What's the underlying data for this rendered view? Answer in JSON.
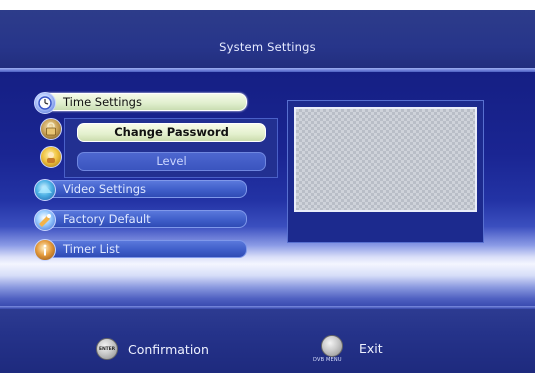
{
  "header": {
    "title": "System Settings"
  },
  "menu": {
    "items": [
      {
        "label": "Time Settings",
        "icon": "clock-icon",
        "state": "highlight"
      },
      {
        "label": "",
        "icon": "lock-icon",
        "state": "normal"
      },
      {
        "label": "",
        "icon": "parental-icon",
        "state": "normal"
      },
      {
        "label": "Video Settings",
        "icon": "video-icon",
        "state": "normal"
      },
      {
        "label": "Factory Default",
        "icon": "factory-default-icon",
        "state": "normal"
      },
      {
        "label": "Timer List",
        "icon": "info-icon",
        "state": "normal"
      }
    ],
    "submenu": [
      {
        "label": "Change Password",
        "state": "highlight"
      },
      {
        "label": "Level",
        "state": "normal"
      }
    ]
  },
  "footer": {
    "confirm": {
      "button_text": "ENTER",
      "label": "Confirmation"
    },
    "exit": {
      "button_text": "DVB MENU",
      "label": "Exit"
    }
  },
  "colors": {
    "accent": "#1a2592",
    "highlight": "#dfeecd",
    "menu_item": "#3f5ec9"
  }
}
